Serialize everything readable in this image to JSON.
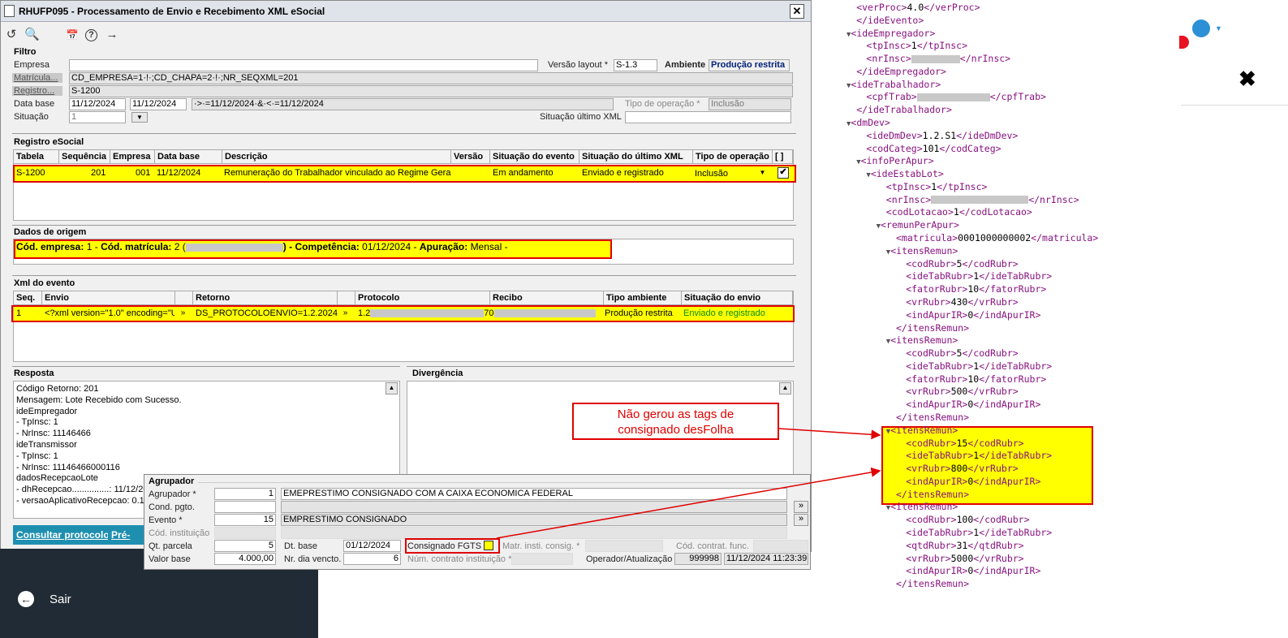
{
  "window": {
    "title": "RHUFP095 - Processamento de Envio e Recebimento XML eSocial",
    "close": "✕"
  },
  "toolbar": [
    "↺",
    "🔍",
    "📅",
    "?",
    "→"
  ],
  "filtro": {
    "section": "Filtro",
    "empresa_label": "Empresa",
    "versao_label": "Versão layout *",
    "versao_value": "S-1.3",
    "ambiente_label": "Ambiente",
    "ambiente_value": "Produção restrita",
    "matricula_label": "Matrícula...",
    "matricula_value": "CD_EMPRESA=1·!·;CD_CHAPA=2·!·;NR_SEQXML=201",
    "registro_label": "Registro...",
    "registro_value": "S-1200",
    "database_label": "Data base",
    "database_from": "11/12/2024",
    "database_to": "11/12/2024",
    "database_expr": "·>·=11/12/2024·&·<·=11/12/2024",
    "tipo_op_label": "Tipo de operação *",
    "tipo_op_value": "Inclusão",
    "situacao_label": "Situação",
    "situacao_value": "1",
    "situacao_ultimo_label": "Situação último XML"
  },
  "registro": {
    "section": "Registro eSocial",
    "headers": [
      "Tabela",
      "Sequência",
      "Empresa",
      "Data base",
      "Descrição",
      "Versão",
      "Situação do evento",
      "Situação do último XML",
      "Tipo de operação",
      "[ ]"
    ],
    "row": {
      "tabela": "S-1200",
      "sequencia": "201",
      "empresa": "001",
      "database": "11/12/2024",
      "descricao": "Remuneração do Trabalhador vinculado ao Regime Geral d",
      "situacao_evento": "Em andamento",
      "situacao_ultimo": "Enviado e registrado",
      "tipo_operacao": "Inclusão",
      "check": "✔"
    }
  },
  "origem": {
    "section": "Dados de origem",
    "cod_empresa_label": "Cód. empresa:",
    "cod_empresa_value": "1 -",
    "cod_matricula_label": "Cód. matrícula:",
    "cod_matricula_value": "2 (",
    "competencia_label": ") - Competência:",
    "competencia_value": "01/12/2024 -",
    "apuracao_label": "Apuração:",
    "apuracao_value": "Mensal -"
  },
  "xml_evento": {
    "section": "Xml do evento",
    "headers": [
      "Seq.",
      "Envio",
      "Retorno",
      "Protocolo",
      "Recibo",
      "Tipo ambiente",
      "Situação do envio"
    ],
    "row": {
      "seq": "1",
      "envio": "<?xml version=\"1.0\" encoding=\"UT",
      "retorno": "DS_PROTOCOLOENVIO=1.2.202412.",
      "protocolo": "1.2",
      "protocolo_end": "70",
      "tipo_ambiente": "Produção restrita",
      "situacao_envio": "Enviado e registrado",
      "expand": "»"
    }
  },
  "resposta": {
    "section": "Resposta",
    "lines": [
      "Código Retorno: 201",
      "Mensagem: Lote Recebido com Sucesso.",
      "ideEmpregador",
      " - TpInsc: 1",
      " - NrInsc: 11146466",
      "ideTransmissor",
      " - TpInsc: 1",
      " - NrInsc: 11146466000116",
      "dadosRecepcaoLote",
      " - dhRecepcao...............: 11/12/20",
      " - versaoAplicativoRecepcao: 0.1."
    ]
  },
  "divergencia": {
    "section": "Divergência"
  },
  "buttons": {
    "consultar": "Consultar protocolo",
    "previsualizar": "Pré-visu"
  },
  "agrupador": {
    "section": "Agrupador",
    "agrupador_label": "Agrupador *",
    "agrupador_value": "1",
    "agrupador_desc": "EMEPRESTIMO CONSIGNADO COM A CAIXA ECONOMICA FEDERAL",
    "cond_label": "Cond. pgto.",
    "evento_label": "Evento *",
    "evento_value": "15",
    "evento_desc": "EMPRESTIMO CONSIGNADO",
    "cod_inst_label": "Cód. instituição",
    "qt_parcela_label": "Qt. parcela",
    "qt_parcela_value": "5",
    "valor_base_label": "Valor base",
    "valor_base_value": "4.000,00",
    "dt_base_label": "Dt. base",
    "dt_base_value": "01/12/2024",
    "nr_dia_label": "Nr. dia vencto.",
    "nr_dia_value": "6",
    "consignado_fgts_label": "Consignado FGTS",
    "matr_inst_label": "Matr. insti. consig. *",
    "cod_contrat_label": "Cód. contrat. func.",
    "num_contrato_label": "Núm. contrato instituição *",
    "operador_label": "Operador/Atualização",
    "operador_value": "999998",
    "atualizacao_value": "11/12/2024 11:23:39",
    "expand": "»"
  },
  "sidebar": {
    "sair": "Sair"
  },
  "annotation": {
    "text_line1": "Não gerou as tags de",
    "text_line2": "consignado desFolha"
  },
  "xml_lines": [
    {
      "i": 1,
      "a": "",
      "t": "<verProc>",
      "v": "4.0",
      "c": "</verProc>"
    },
    {
      "i": 1,
      "a": "",
      "t": "</ideEvento>",
      "v": "",
      "c": ""
    },
    {
      "i": 0,
      "a": "▼",
      "t": "<ideEmpregador>",
      "v": "",
      "c": ""
    },
    {
      "i": 2,
      "a": "",
      "t": "<tpInsc>",
      "v": "1",
      "c": "</tpInsc>"
    },
    {
      "i": 2,
      "a": "",
      "t": "<nrInsc>",
      "v": "",
      "c": "</nrInsc>",
      "blur": 60
    },
    {
      "i": 1,
      "a": "",
      "t": "</ideEmpregador>",
      "v": "",
      "c": ""
    },
    {
      "i": 0,
      "a": "▼",
      "t": "<ideTrabalhador>",
      "v": "",
      "c": ""
    },
    {
      "i": 2,
      "a": "",
      "t": "<cpfTrab>",
      "v": "",
      "c": "</cpfTrab>",
      "blur": 90
    },
    {
      "i": 1,
      "a": "",
      "t": "</ideTrabalhador>",
      "v": "",
      "c": ""
    },
    {
      "i": 0,
      "a": "▼",
      "t": "<dmDev>",
      "v": "",
      "c": ""
    },
    {
      "i": 2,
      "a": "",
      "t": "<ideDmDev>",
      "v": "1.2.S1",
      "c": "</ideDmDev>"
    },
    {
      "i": 2,
      "a": "",
      "t": "<codCateg>",
      "v": "101",
      "c": "</codCateg>"
    },
    {
      "i": 1,
      "a": "▼",
      "t": "<infoPerApur>",
      "v": "",
      "c": ""
    },
    {
      "i": 2,
      "a": "▼",
      "t": "<ideEstabLot>",
      "v": "",
      "c": ""
    },
    {
      "i": 4,
      "a": "",
      "t": "<tpInsc>",
      "v": "1",
      "c": "</tpInsc>"
    },
    {
      "i": 4,
      "a": "",
      "t": "<nrInsc>",
      "v": "",
      "c": "</nrInsc>",
      "blur": 120
    },
    {
      "i": 4,
      "a": "",
      "t": "<codLotacao>",
      "v": "1",
      "c": "</codLotacao>"
    },
    {
      "i": 3,
      "a": "▼",
      "t": "<remunPerApur>",
      "v": "",
      "c": ""
    },
    {
      "i": 5,
      "a": "",
      "t": "<matricula>",
      "v": "0001000000002",
      "c": "</matricula>"
    },
    {
      "i": 4,
      "a": "▼",
      "t": "<itensRemun>",
      "v": "",
      "c": ""
    },
    {
      "i": 6,
      "a": "",
      "t": "<codRubr>",
      "v": "5",
      "c": "</codRubr>"
    },
    {
      "i": 6,
      "a": "",
      "t": "<ideTabRubr>",
      "v": "1",
      "c": "</ideTabRubr>"
    },
    {
      "i": 6,
      "a": "",
      "t": "<fatorRubr>",
      "v": "10",
      "c": "</fatorRubr>"
    },
    {
      "i": 6,
      "a": "",
      "t": "<vrRubr>",
      "v": "430",
      "c": "</vrRubr>"
    },
    {
      "i": 6,
      "a": "",
      "t": "<indApurIR>",
      "v": "0",
      "c": "</indApurIR>"
    },
    {
      "i": 5,
      "a": "",
      "t": "</itensRemun>",
      "v": "",
      "c": ""
    },
    {
      "i": 4,
      "a": "▼",
      "t": "<itensRemun>",
      "v": "",
      "c": ""
    },
    {
      "i": 6,
      "a": "",
      "t": "<codRubr>",
      "v": "5",
      "c": "</codRubr>"
    },
    {
      "i": 6,
      "a": "",
      "t": "<ideTabRubr>",
      "v": "1",
      "c": "</ideTabRubr>"
    },
    {
      "i": 6,
      "a": "",
      "t": "<fatorRubr>",
      "v": "10",
      "c": "</fatorRubr>"
    },
    {
      "i": 6,
      "a": "",
      "t": "<vrRubr>",
      "v": "500",
      "c": "</vrRubr>"
    },
    {
      "i": 6,
      "a": "",
      "t": "<indApurIR>",
      "v": "0",
      "c": "</indApurIR>"
    },
    {
      "i": 5,
      "a": "",
      "t": "</itensRemun>",
      "v": "",
      "c": ""
    },
    {
      "i": 4,
      "a": "▼",
      "t": "<itensRemun>",
      "v": "",
      "c": ""
    },
    {
      "i": 6,
      "a": "",
      "t": "<codRubr>",
      "v": "15",
      "c": "</codRubr>"
    },
    {
      "i": 6,
      "a": "",
      "t": "<ideTabRubr>",
      "v": "1",
      "c": "</ideTabRubr>"
    },
    {
      "i": 6,
      "a": "",
      "t": "<vrRubr>",
      "v": "800",
      "c": "</vrRubr>"
    },
    {
      "i": 6,
      "a": "",
      "t": "<indApurIR>",
      "v": "0",
      "c": "</indApurIR>"
    },
    {
      "i": 5,
      "a": "",
      "t": "</itensRemun>",
      "v": "",
      "c": ""
    },
    {
      "i": 4,
      "a": "▼",
      "t": "<itensRemun>",
      "v": "",
      "c": ""
    },
    {
      "i": 6,
      "a": "",
      "t": "<codRubr>",
      "v": "100",
      "c": "</codRubr>"
    },
    {
      "i": 6,
      "a": "",
      "t": "<ideTabRubr>",
      "v": "1",
      "c": "</ideTabRubr>"
    },
    {
      "i": 6,
      "a": "",
      "t": "<qtdRubr>",
      "v": "31",
      "c": "</qtdRubr>"
    },
    {
      "i": 6,
      "a": "",
      "t": "<vrRubr>",
      "v": "5000",
      "c": "</vrRubr>"
    },
    {
      "i": 6,
      "a": "",
      "t": "<indApurIR>",
      "v": "0",
      "c": "</indApurIR>"
    },
    {
      "i": 5,
      "a": "",
      "t": "</itensRemun>",
      "v": "",
      "c": ""
    }
  ],
  "colors": {
    "highlight": "#ffff00",
    "annotation_red": "#e00000",
    "tag": "#881280",
    "button_blue": "#1f8fb0",
    "dark_panel": "#212b35"
  }
}
